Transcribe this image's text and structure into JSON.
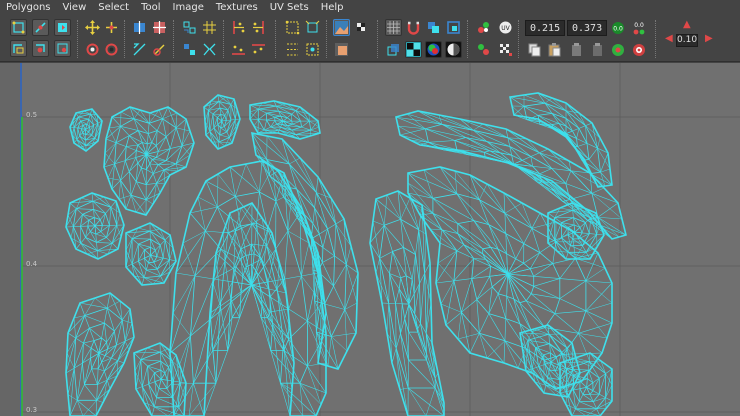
{
  "menubar": {
    "items": [
      "Polygons",
      "View",
      "Select",
      "Tool",
      "Image",
      "Textures",
      "UV Sets",
      "Help"
    ]
  },
  "toolbar": {
    "u_value": "0.215",
    "v_value": "0.373",
    "step_value": "0.10",
    "badge_00": "0.0",
    "badge_01": "0.0"
  },
  "viewport": {
    "axis_labels": [
      "0.5",
      "0.4",
      "0.3"
    ]
  },
  "colors": {
    "wireframe": "#3ee0ec",
    "uv_background": "#707070",
    "grid": "#5f5f5f",
    "u_axis": "#2ec02e",
    "accent_red": "#e04848"
  }
}
